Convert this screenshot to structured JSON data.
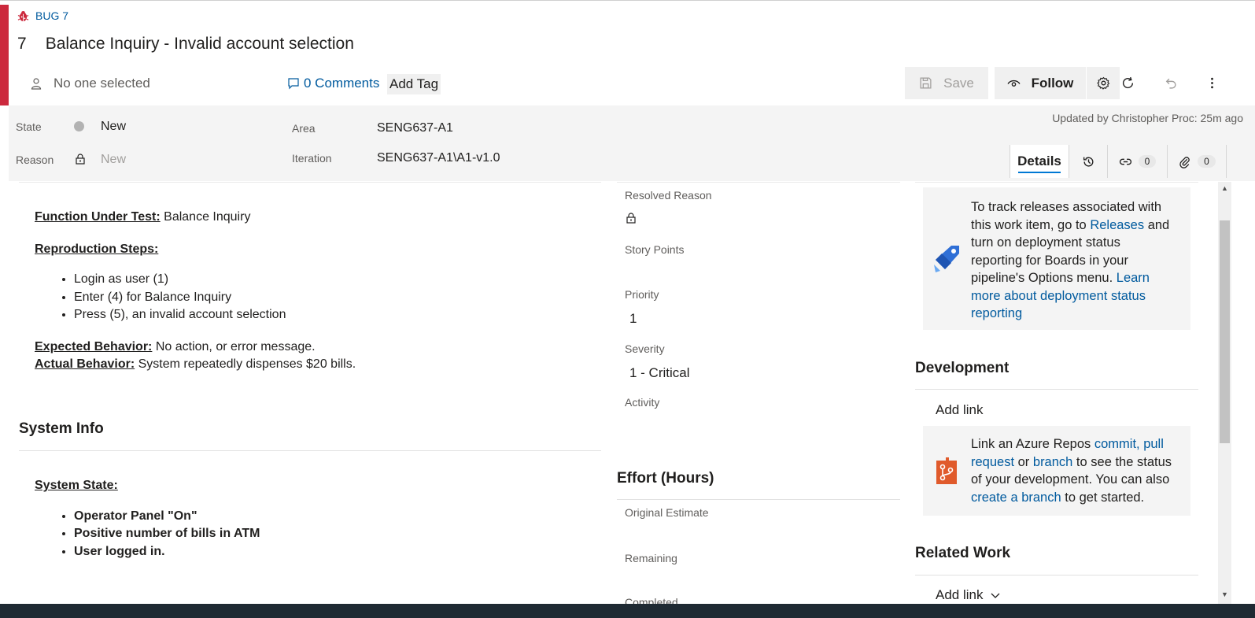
{
  "header": {
    "type_label": "BUG 7",
    "id": "7",
    "title": "Balance Inquiry - Invalid account selection",
    "assigned_to": "No one selected",
    "comments": "0 Comments",
    "add_tag": "Add Tag",
    "accent_color": "#cc293d"
  },
  "toolbar": {
    "save_label": "Save",
    "follow_label": "Follow",
    "icons": [
      "save-icon",
      "eye-icon",
      "gear-icon",
      "refresh-icon",
      "undo-icon",
      "more-icon"
    ]
  },
  "fields": {
    "state_label": "State",
    "state_value": "New",
    "reason_label": "Reason",
    "reason_value": "New",
    "area_label": "Area",
    "area_value": "SENG637-A1",
    "iteration_label": "Iteration",
    "iteration_value": "SENG637-A1\\A1-v1.0"
  },
  "updated": "Updated by Christopher Proc: 25m ago",
  "tabs": {
    "details": "Details",
    "links_count": "0",
    "attachments_count": "0"
  },
  "description": {
    "fut_label": "Function Under Test:",
    "fut_value": " Balance Inquiry",
    "repro_label": "Reproduction Steps:",
    "steps": [
      "Login as user (1)",
      "Enter (4) for Balance Inquiry",
      "Press (5), an invalid account selection"
    ],
    "expected_label": "Expected Behavior:",
    "expected_value": " No action, or error message.",
    "actual_label": "Actual Behavior:",
    "actual_value": " System repeatedly dispenses $20 bills."
  },
  "system_info": {
    "title": "System Info",
    "state_label": "System State:",
    "items": [
      "Operator Panel \"On\"",
      "Positive number of bills in ATM",
      "User logged in."
    ]
  },
  "planning": {
    "resolved_reason_label": "Resolved Reason",
    "story_points_label": "Story Points",
    "priority_label": "Priority",
    "priority_value": "1",
    "severity_label": "Severity",
    "severity_value": "1 - Critical",
    "activity_label": "Activity"
  },
  "effort": {
    "title": "Effort (Hours)",
    "original_estimate_label": "Original Estimate",
    "remaining_label": "Remaining",
    "completed_label": "Completed"
  },
  "deployment": {
    "text_1": "To track releases associated with",
    "text_2": "this work item, go to ",
    "releases_link": "Releases",
    "text_3": " and",
    "text_4": "turn on deployment status",
    "text_5": "reporting for Boards in your",
    "text_6": "pipeline's Options menu. ",
    "learn_1": "Learn",
    "learn_2": "more about deployment status",
    "learn_3": "reporting"
  },
  "development": {
    "title": "Development",
    "add_link": "Add link",
    "text_1": "Link an Azure Repos ",
    "commit_link": "commit,",
    "pull_link_1": " pull",
    "pull_link_2": "request",
    "or_text": " or ",
    "branch_link": "branch",
    "text_2": " to see the status",
    "text_3": "of your development. You can also",
    "create_branch_link": "create a branch",
    "text_4": " to get started."
  },
  "related_work": {
    "title": "Related Work",
    "add_link": "Add link"
  }
}
